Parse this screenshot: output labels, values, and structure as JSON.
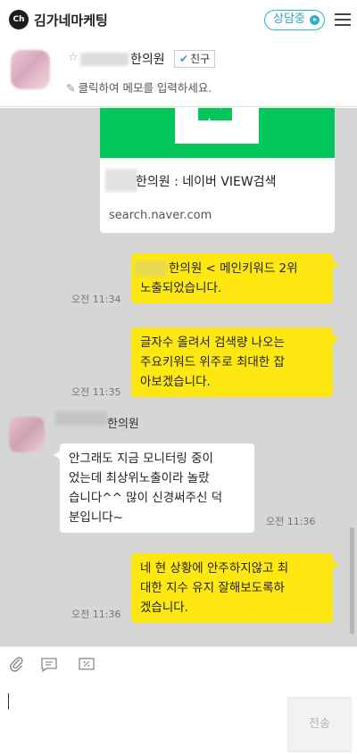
{
  "header": {
    "logo_text": "Ch",
    "title": "김가네마케팅",
    "status_label": "상담중"
  },
  "profile": {
    "contact_name": "한의원",
    "friend_badge": "친구",
    "memo_placeholder": "클릭하여 메모를 입력하세요."
  },
  "link_card": {
    "title": "한의원 : 네이버 VIEW검색",
    "url": "search.naver.com",
    "brand_color": "#03c75a"
  },
  "messages": [
    {
      "from": "me",
      "text_lines": [
        "한의원 < 메인키워드 2위",
        "노출되었습니다."
      ],
      "time": "오전 11:34"
    },
    {
      "from": "me",
      "text_lines": [
        "글자수 올려서 검색량 나오는",
        "주요키워드 위주로 최대한 잡",
        "아보겠습니다."
      ],
      "time": "오전 11:35"
    },
    {
      "from": "other",
      "sender": "한의원",
      "text_lines": [
        "안그래도 지금 모니터링 중이",
        "었는데 최상위노출이라 놀랐",
        "습니다^^ 많이 신경써주신 덕",
        "분입니다~"
      ],
      "time": "오전 11:36"
    },
    {
      "from": "me",
      "text_lines": [
        "네 현 상황에 안주하지않고 최",
        "대한 지수 유지 잘해보도록하",
        "겠습니다."
      ],
      "time": "오전 11:36"
    }
  ],
  "composer": {
    "send_label": "전송",
    "tools": [
      "paperclip-icon",
      "template-icon",
      "coupon-icon"
    ]
  },
  "colors": {
    "my_bubble": "#ffe812",
    "their_bubble": "#ffffff",
    "chat_bg": "#d6d6d6",
    "accent": "#2fb2c8"
  }
}
